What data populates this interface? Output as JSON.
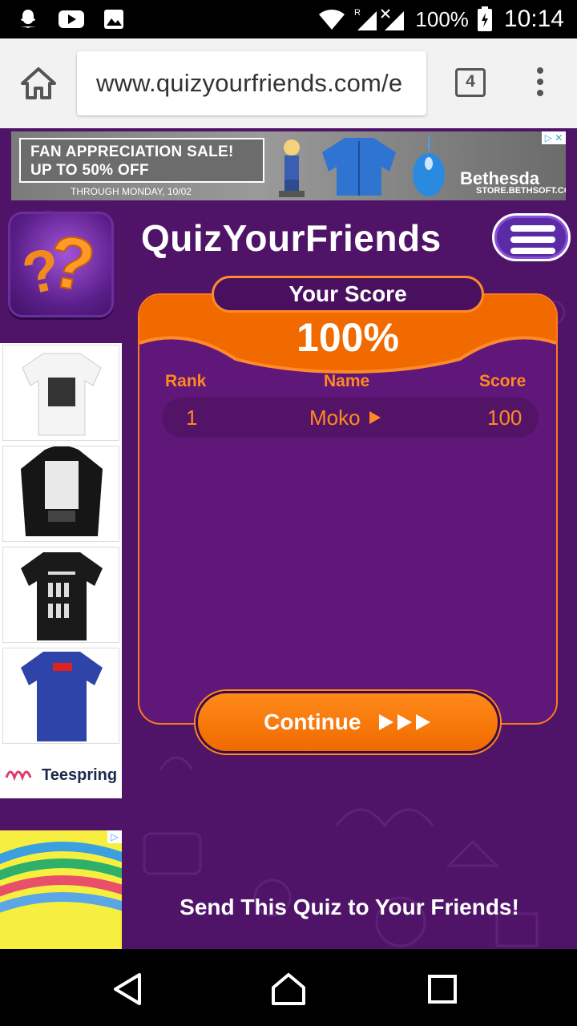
{
  "status_bar": {
    "battery": "100%",
    "time": "10:14",
    "icons": [
      "snapchat-icon",
      "youtube-icon",
      "gallery-icon",
      "wifi-icon",
      "signal-icon",
      "battery-icon"
    ]
  },
  "browser": {
    "url": "www.quizyourfriends.com/e",
    "tab_count": "4",
    "icons": [
      "home-icon",
      "overflow-menu-icon"
    ]
  },
  "banner_ad": {
    "line1": "FAN APPRECIATION SALE!",
    "line2": "UP TO 50% OFF",
    "sub": "THROUGH MONDAY, 10/02",
    "brand": "Bethesda",
    "brand_sub": "STORE.BETHSOFT.COM"
  },
  "header": {
    "title": "QuizYourFriends"
  },
  "score_card": {
    "heading": "Your Score",
    "score": "100%",
    "columns": {
      "rank": "Rank",
      "name": "Name",
      "score": "Score"
    },
    "rows": [
      {
        "rank": "1",
        "name": "Moko",
        "score": "100"
      }
    ],
    "continue_label": "Continue"
  },
  "side_ad": {
    "brand": "Teespring"
  },
  "share": {
    "text": "Send This Quiz to Your Friends!"
  },
  "colors": {
    "page_bg": "#4f1468",
    "card_bg": "#60177a",
    "accent_orange": "#f06a00",
    "accent_text": "#ff8a1f"
  }
}
